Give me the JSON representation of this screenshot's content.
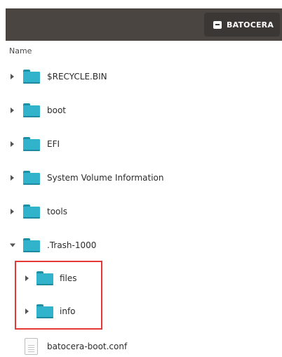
{
  "header": {
    "drive_label": "BATOCERA",
    "drive_icon": "drive-icon"
  },
  "columns": {
    "name": "Name"
  },
  "items": [
    {
      "label": "$RECYCLE.BIN",
      "type": "folder",
      "expanded": false,
      "depth": 0
    },
    {
      "label": "boot",
      "type": "folder",
      "expanded": false,
      "depth": 0
    },
    {
      "label": "EFI",
      "type": "folder",
      "expanded": false,
      "depth": 0
    },
    {
      "label": "System Volume Information",
      "type": "folder",
      "expanded": false,
      "depth": 0
    },
    {
      "label": "tools",
      "type": "folder",
      "expanded": false,
      "depth": 0
    },
    {
      "label": ".Trash-1000",
      "type": "folder",
      "expanded": true,
      "depth": 0
    },
    {
      "label": "files",
      "type": "folder",
      "expanded": false,
      "depth": 1
    },
    {
      "label": "info",
      "type": "folder",
      "expanded": false,
      "depth": 1
    },
    {
      "label": "batocera-boot.conf",
      "type": "file",
      "depth": 0
    }
  ],
  "colors": {
    "header_bg": "#4a4541",
    "folder": "#31b3cc",
    "highlight": "#e53935"
  }
}
